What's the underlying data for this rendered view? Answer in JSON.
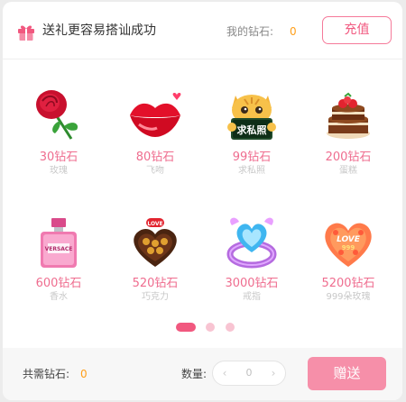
{
  "header": {
    "title": "送礼更容易搭讪成功",
    "balance_label": "我的钻石:",
    "balance_value": "0",
    "recharge_label": "充值",
    "icon": "gift-icon"
  },
  "gifts": [
    {
      "price": "30钻石",
      "name": "玫瑰",
      "icon": "rose-icon"
    },
    {
      "price": "80钻石",
      "name": "飞吻",
      "icon": "lips-kiss-icon"
    },
    {
      "price": "99钻石",
      "name": "求私照",
      "icon": "cat-sign-icon",
      "sign_text": "求私照"
    },
    {
      "price": "200钻石",
      "name": "蛋糕",
      "icon": "cake-icon"
    },
    {
      "price": "600钻石",
      "name": "香水",
      "icon": "perfume-icon",
      "label_text": "VERSACE"
    },
    {
      "price": "520钻石",
      "name": "巧克力",
      "icon": "chocolate-box-icon",
      "label_text": "LOVE"
    },
    {
      "price": "3000钻石",
      "name": "戒指",
      "icon": "heart-ring-icon"
    },
    {
      "price": "5200钻石",
      "name": "999朵玫瑰",
      "icon": "rose-heart-icon",
      "label_text": "LOVE",
      "sub_text": "999"
    }
  ],
  "pagination": {
    "pages": 3,
    "current": 1
  },
  "footer": {
    "total_label": "共需钻石:",
    "total_value": "0",
    "qty_label": "数量:",
    "qty_value": "0",
    "qty_minus": "‹",
    "qty_plus": "›",
    "send_label": "赠送"
  },
  "colors": {
    "accent": "#f1587f",
    "send_button": "#f68fa9",
    "diamond_value": "#ff9f1a",
    "price_text": "#ef6d8f"
  }
}
